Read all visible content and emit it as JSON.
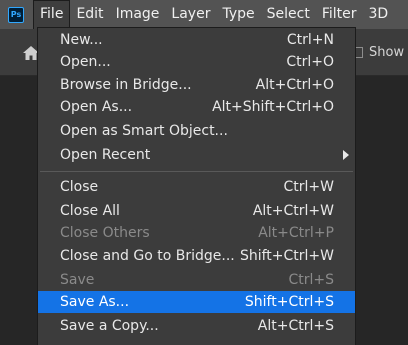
{
  "app": {
    "logo": "Ps"
  },
  "menubar": {
    "items": [
      {
        "label": "File"
      },
      {
        "label": "Edit"
      },
      {
        "label": "Image"
      },
      {
        "label": "Layer"
      },
      {
        "label": "Type"
      },
      {
        "label": "Select"
      },
      {
        "label": "Filter"
      },
      {
        "label": "3D"
      }
    ]
  },
  "optionsbar": {
    "home_icon": "home-icon",
    "show_label": "Show"
  },
  "file_menu": {
    "items": [
      {
        "label": "New...",
        "shortcut": "Ctrl+N"
      },
      {
        "label": "Open...",
        "shortcut": "Ctrl+O"
      },
      {
        "label": "Browse in Bridge...",
        "shortcut": "Alt+Ctrl+O"
      },
      {
        "label": "Open As...",
        "shortcut": "Alt+Shift+Ctrl+O"
      },
      {
        "label": "Open as Smart Object...",
        "shortcut": ""
      },
      {
        "label": "Open Recent",
        "shortcut": ""
      },
      {
        "label": "Close",
        "shortcut": "Ctrl+W"
      },
      {
        "label": "Close All",
        "shortcut": "Alt+Ctrl+W"
      },
      {
        "label": "Close Others",
        "shortcut": "Alt+Ctrl+P"
      },
      {
        "label": "Close and Go to Bridge...",
        "shortcut": "Shift+Ctrl+W"
      },
      {
        "label": "Save",
        "shortcut": "Ctrl+S"
      },
      {
        "label": "Save As...",
        "shortcut": "Shift+Ctrl+S"
      },
      {
        "label": "Save a Copy...",
        "shortcut": "Alt+Ctrl+S"
      }
    ]
  },
  "colors": {
    "highlight": "#1473e6",
    "menubar": "#535353",
    "menu_bg": "#3c3c3c",
    "disabled_text": "#8a8a8a"
  }
}
